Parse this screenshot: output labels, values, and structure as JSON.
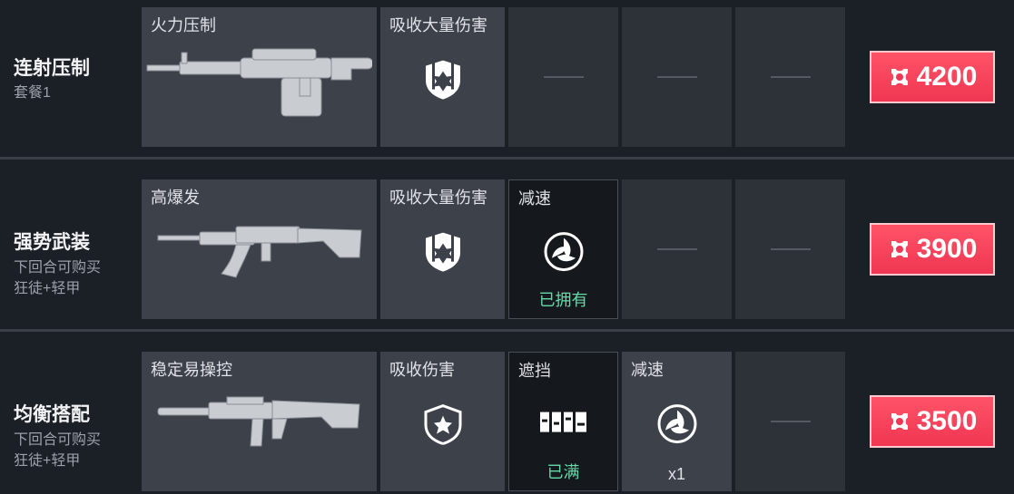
{
  "packages": [
    {
      "title": "连射压制",
      "sub1": "套餐1",
      "sub2": "",
      "weapon_label": "火力压制",
      "slot_a_label": "吸收大量伤害",
      "slot_a_icon": "armor-heavy-icon",
      "price": "4200"
    },
    {
      "title": "强势武装",
      "sub1": "下回合可购买",
      "sub2": "狂徒+轻甲",
      "weapon_label": "高爆发",
      "slot_a_label": "吸收大量伤害",
      "slot_a_icon": "armor-heavy-icon",
      "slot_b_label": "减速",
      "slot_b_icon": "slow-grenade-icon",
      "slot_b_status": "已拥有",
      "price": "3900"
    },
    {
      "title": "均衡搭配",
      "sub1": "下回合可购买",
      "sub2": "狂徒+轻甲",
      "weapon_label": "稳定易操控",
      "slot_a_label": "吸收伤害",
      "slot_a_icon": "armor-light-icon",
      "slot_b_label": "遮挡",
      "slot_b_icon": "wall-ability-icon",
      "slot_b_status": "已满",
      "slot_c_label": "减速",
      "slot_c_icon": "slow-grenade-icon",
      "slot_c_count": "x1",
      "price": "3500"
    }
  ],
  "colors": {
    "price_bg": "#f03652",
    "owned_text": "#66d9a8",
    "cell_bg": "#3c414a"
  }
}
